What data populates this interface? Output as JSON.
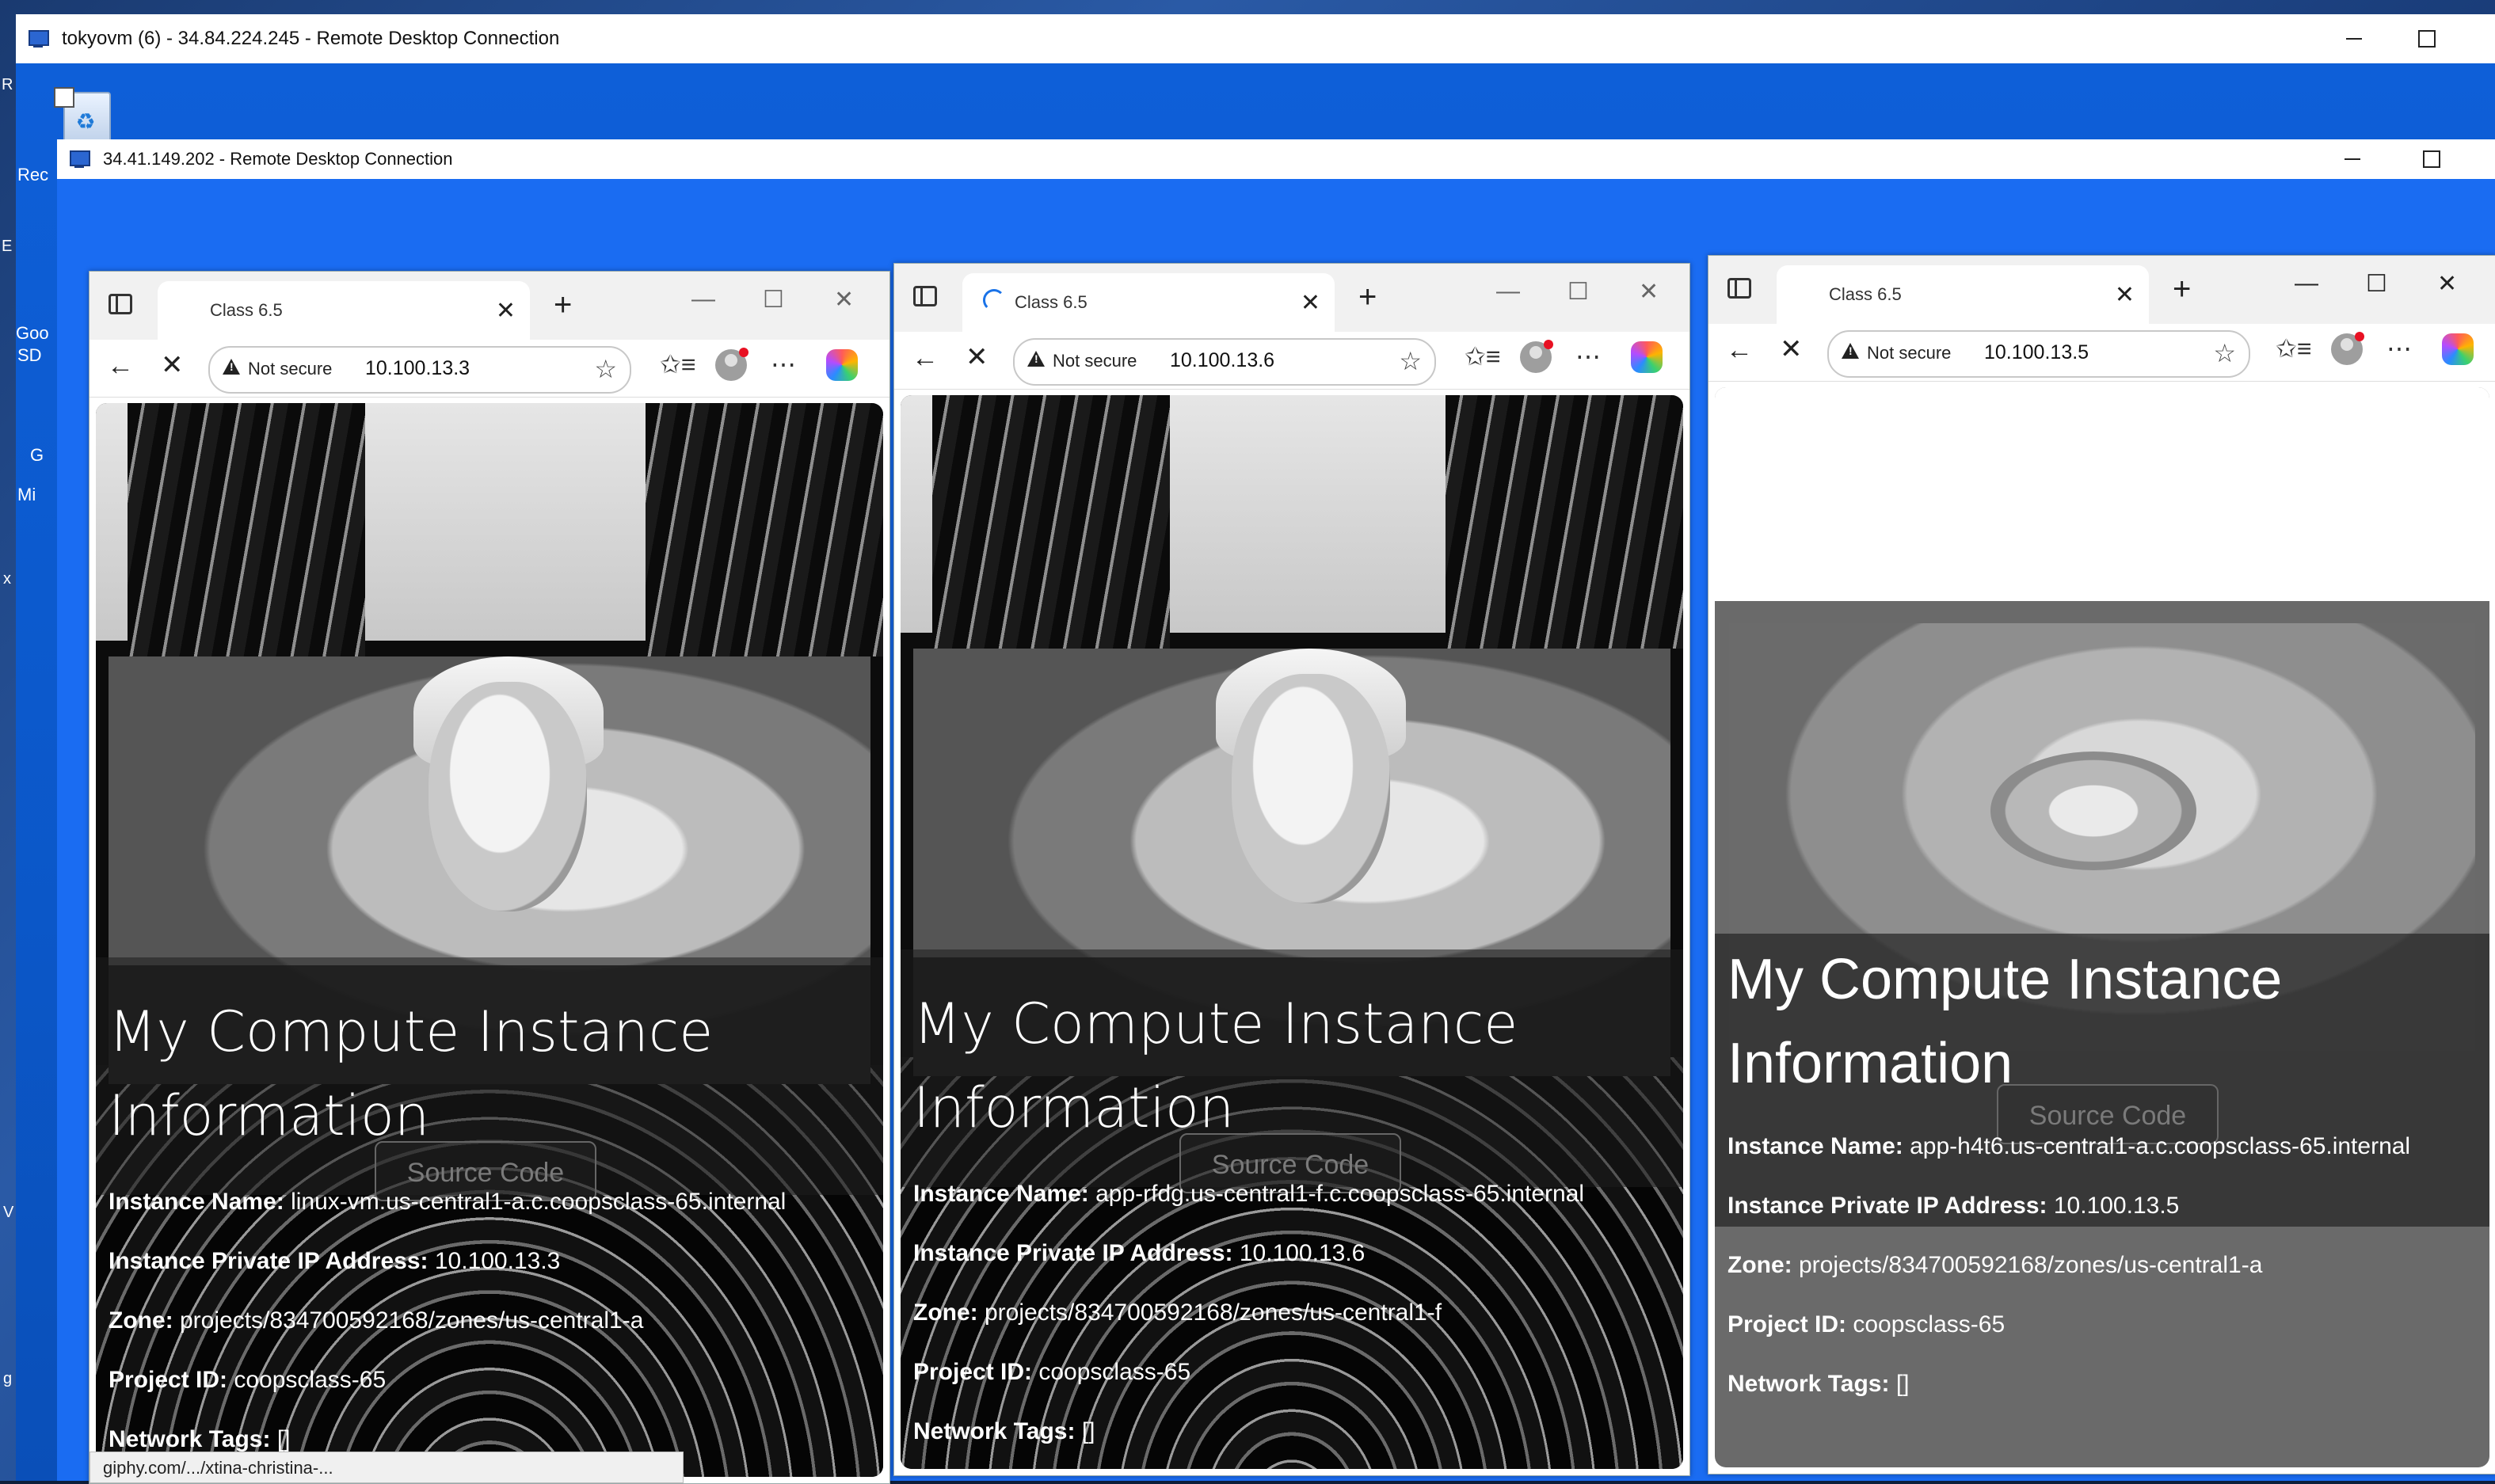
{
  "outer_window": {
    "title": "tokyovm (6) - 34.84.224.245 - Remote Desktop Connection",
    "desktop_labels": [
      "Rec",
      "Goo",
      "SD",
      "Mi",
      "G"
    ]
  },
  "inner_window": {
    "title": "34.41.149.202 - Remote Desktop Connection"
  },
  "browsers": [
    {
      "tab_title": "Class 6.5",
      "security_label": "Not secure",
      "url": "10.100.13.3",
      "page": {
        "heading_line1": "My Compute Instance",
        "heading_line2": "Information",
        "source_code_label": "Source Code",
        "instance_name_label": "Instance Name:",
        "instance_name": "linux-vm.us-central1-a.c.coopsclass-65.internal",
        "private_ip_label": "Instance Private IP Address:",
        "private_ip": "10.100.13.3",
        "zone_label": "Zone:",
        "zone": "projects/834700592168/zones/us-central1-a",
        "project_label": "Project ID:",
        "project": "coopsclass-65",
        "tags_label": "Network Tags:",
        "tags": "[]"
      },
      "status_url": "giphy.com/.../xtina-christina-..."
    },
    {
      "tab_title": "Class 6.5",
      "security_label": "Not secure",
      "url": "10.100.13.6",
      "page": {
        "heading_line1": "My Compute Instance",
        "heading_line2": "Information",
        "source_code_label": "Source Code",
        "instance_name_label": "Instance Name:",
        "instance_name": "app-rfdg.us-central1-f.c.coopsclass-65.internal",
        "private_ip_label": "Instance Private IP Address:",
        "private_ip": "10.100.13.6",
        "zone_label": "Zone:",
        "zone": "projects/834700592168/zones/us-central1-f",
        "project_label": "Project ID:",
        "project": "coopsclass-65",
        "tags_label": "Network Tags:",
        "tags": "[]"
      }
    },
    {
      "tab_title": "Class 6.5",
      "security_label": "Not secure",
      "url": "10.100.13.5",
      "page": {
        "heading_line1": "My Compute Instance",
        "heading_line2": "Information",
        "source_code_label": "Source Code",
        "instance_name_label": "Instance Name:",
        "instance_name": "app-h4t6.us-central1-a.c.coopsclass-65.internal",
        "private_ip_label": "Instance Private IP Address:",
        "private_ip": "10.100.13.5",
        "zone_label": "Zone:",
        "zone": "projects/834700592168/zones/us-central1-a",
        "project_label": "Project ID:",
        "project": "coopsclass-65",
        "tags_label": "Network Tags:",
        "tags": "[]"
      }
    }
  ],
  "icons": {
    "sidebar_toggle": "sidebar-icon",
    "back": "←",
    "stop": "✕",
    "favorite": "☆",
    "favorites": "✩≡",
    "more": "⋯",
    "new_tab": "+",
    "close": "✕"
  },
  "colors": {
    "outer_titlebar": "#ffffff",
    "desktop_blue": "#0b57c8",
    "rdp_blue": "#0a60e6",
    "status_dot": "#e81123"
  }
}
